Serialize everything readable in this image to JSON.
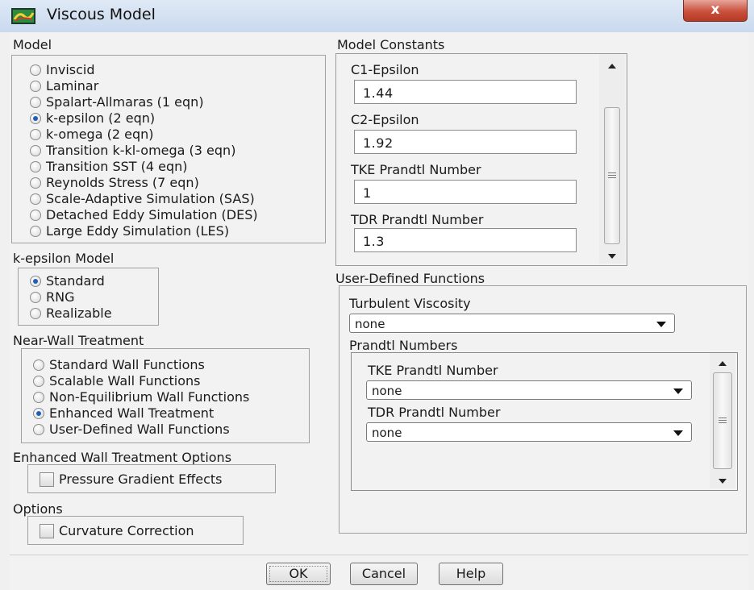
{
  "window": {
    "title": "Viscous Model",
    "close_label": "x"
  },
  "model": {
    "title": "Model",
    "options": [
      {
        "label": "Inviscid",
        "selected": false
      },
      {
        "label": "Laminar",
        "selected": false
      },
      {
        "label": "Spalart-Allmaras (1 eqn)",
        "selected": false
      },
      {
        "label": "k-epsilon (2 eqn)",
        "selected": true
      },
      {
        "label": "k-omega (2 eqn)",
        "selected": false
      },
      {
        "label": "Transition k-kl-omega (3 eqn)",
        "selected": false
      },
      {
        "label": "Transition SST (4 eqn)",
        "selected": false
      },
      {
        "label": "Reynolds Stress (7 eqn)",
        "selected": false
      },
      {
        "label": "Scale-Adaptive Simulation (SAS)",
        "selected": false
      },
      {
        "label": "Detached Eddy Simulation (DES)",
        "selected": false
      },
      {
        "label": "Large Eddy Simulation (LES)",
        "selected": false
      }
    ]
  },
  "kepsilon_model": {
    "title": "k-epsilon Model",
    "options": [
      {
        "label": "Standard",
        "selected": true
      },
      {
        "label": "RNG",
        "selected": false
      },
      {
        "label": "Realizable",
        "selected": false
      }
    ]
  },
  "near_wall": {
    "title": "Near-Wall Treatment",
    "options": [
      {
        "label": "Standard Wall Functions",
        "selected": false
      },
      {
        "label": "Scalable Wall Functions",
        "selected": false
      },
      {
        "label": "Non-Equilibrium Wall Functions",
        "selected": false
      },
      {
        "label": "Enhanced Wall Treatment",
        "selected": true
      },
      {
        "label": "User-Defined Wall Functions",
        "selected": false
      }
    ]
  },
  "enhanced_wall_options": {
    "title": "Enhanced Wall Treatment Options",
    "checkbox_label": "Pressure Gradient Effects",
    "checked": false
  },
  "options": {
    "title": "Options",
    "checkbox_label": "Curvature Correction",
    "checked": false
  },
  "model_constants": {
    "title": "Model Constants",
    "fields": [
      {
        "label": "C1-Epsilon",
        "value": "1.44"
      },
      {
        "label": "C2-Epsilon",
        "value": "1.92"
      },
      {
        "label": "TKE Prandtl Number",
        "value": "1"
      },
      {
        "label": "TDR Prandtl Number",
        "value": "1.3"
      }
    ]
  },
  "udf": {
    "title": "User-Defined Functions",
    "turbulent_viscosity": {
      "label": "Turbulent Viscosity",
      "value": "none"
    },
    "prandtl": {
      "title": "Prandtl Numbers",
      "tke": {
        "label": "TKE Prandtl Number",
        "value": "none"
      },
      "tdr": {
        "label": "TDR Prandtl Number",
        "value": "none"
      }
    }
  },
  "buttons": {
    "ok": "OK",
    "cancel": "Cancel",
    "help": "Help"
  },
  "icons": {
    "app": "fluent-app-icon",
    "scroll_up": "scroll-up-arrow-icon",
    "scroll_down": "scroll-down-arrow-icon",
    "dropdown": "chevron-down-icon"
  },
  "colors": {
    "title_bar": "#c9d9ee",
    "close_button": "#c9503c",
    "radio_selected": "#1f5fb5"
  }
}
